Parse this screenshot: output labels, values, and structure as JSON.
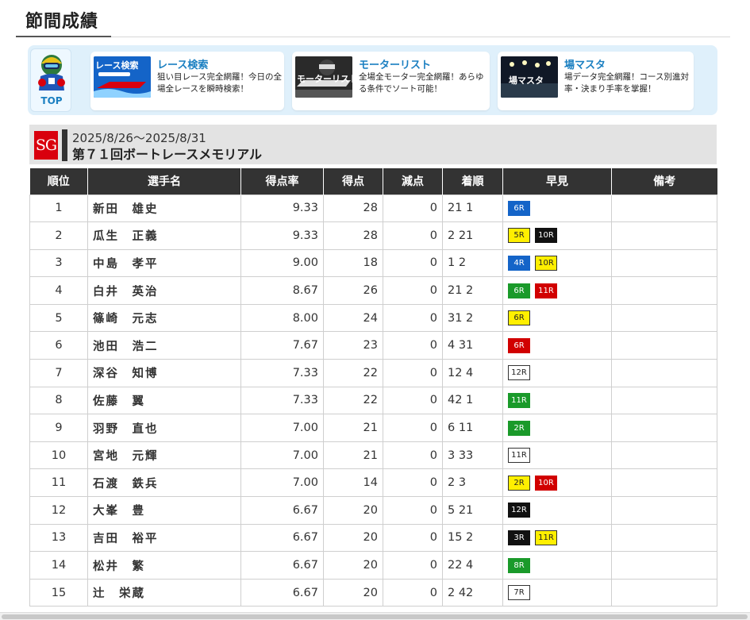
{
  "page_title": "節間成績",
  "nav": {
    "top_label": "TOP",
    "cards": [
      {
        "title": "レース検索",
        "desc": "狙い目レース完全網羅！今日の全場全レースを瞬時検索！",
        "thumb_text": "レース検索"
      },
      {
        "title": "モーターリスト",
        "desc": "全場全モーター完全網羅！あらゆる条件でソート可能！",
        "thumb_text": "モーターリスト"
      },
      {
        "title": "場マスタ",
        "desc": "場データ完全網羅！コース別進対率・決まり手率を掌握！",
        "thumb_text": "場マスタ"
      }
    ]
  },
  "race": {
    "grade": "SG",
    "dates": "2025/8/26〜2025/8/31",
    "name": "第７１回ボートレースメモリアル"
  },
  "table": {
    "headers": [
      "順位",
      "選手名",
      "得点率",
      "得点",
      "減点",
      "着順",
      "早見",
      "備考"
    ],
    "rows": [
      {
        "rank": "1",
        "name": "新田　雄史",
        "rate": "9.33",
        "points": "28",
        "deduct": "0",
        "order": "21 1",
        "tags": [
          {
            "label": "6R",
            "color": "blue"
          }
        ],
        "note": ""
      },
      {
        "rank": "2",
        "name": "瓜生　正義",
        "rate": "9.33",
        "points": "28",
        "deduct": "0",
        "order": "2 21",
        "tags": [
          {
            "label": "5R",
            "color": "yellow"
          },
          {
            "label": "10R",
            "color": "black"
          }
        ],
        "note": ""
      },
      {
        "rank": "3",
        "name": "中島　孝平",
        "rate": "9.00",
        "points": "18",
        "deduct": "0",
        "order": "1 2",
        "tags": [
          {
            "label": "4R",
            "color": "blue"
          },
          {
            "label": "10R",
            "color": "yellow"
          }
        ],
        "note": ""
      },
      {
        "rank": "4",
        "name": "白井　英治",
        "rate": "8.67",
        "points": "26",
        "deduct": "0",
        "order": "21 2",
        "tags": [
          {
            "label": "6R",
            "color": "green"
          },
          {
            "label": "11R",
            "color": "red"
          }
        ],
        "note": ""
      },
      {
        "rank": "5",
        "name": "篠崎　元志",
        "rate": "8.00",
        "points": "24",
        "deduct": "0",
        "order": "31 2",
        "tags": [
          {
            "label": "6R",
            "color": "yellow"
          }
        ],
        "note": ""
      },
      {
        "rank": "6",
        "name": "池田　浩二",
        "rate": "7.67",
        "points": "23",
        "deduct": "0",
        "order": "4 31",
        "tags": [
          {
            "label": "6R",
            "color": "red"
          }
        ],
        "note": ""
      },
      {
        "rank": "7",
        "name": "深谷　知博",
        "rate": "7.33",
        "points": "22",
        "deduct": "0",
        "order": "12 4",
        "tags": [
          {
            "label": "12R",
            "color": "white"
          }
        ],
        "note": ""
      },
      {
        "rank": "8",
        "name": "佐藤　翼",
        "rate": "7.33",
        "points": "22",
        "deduct": "0",
        "order": "42 1",
        "tags": [
          {
            "label": "11R",
            "color": "green"
          }
        ],
        "note": ""
      },
      {
        "rank": "9",
        "name": "羽野　直也",
        "rate": "7.00",
        "points": "21",
        "deduct": "0",
        "order": "6 11",
        "tags": [
          {
            "label": "2R",
            "color": "green"
          }
        ],
        "note": ""
      },
      {
        "rank": "10",
        "name": "宮地　元輝",
        "rate": "7.00",
        "points": "21",
        "deduct": "0",
        "order": "3 33",
        "tags": [
          {
            "label": "11R",
            "color": "white"
          }
        ],
        "note": ""
      },
      {
        "rank": "11",
        "name": "石渡　鉄兵",
        "rate": "7.00",
        "points": "14",
        "deduct": "0",
        "order": "2 3",
        "tags": [
          {
            "label": "2R",
            "color": "yellow"
          },
          {
            "label": "10R",
            "color": "red"
          }
        ],
        "note": ""
      },
      {
        "rank": "12",
        "name": "大峯　豊",
        "rate": "6.67",
        "points": "20",
        "deduct": "0",
        "order": "5 21",
        "tags": [
          {
            "label": "12R",
            "color": "black"
          }
        ],
        "note": ""
      },
      {
        "rank": "13",
        "name": "吉田　裕平",
        "rate": "6.67",
        "points": "20",
        "deduct": "0",
        "order": "15 2",
        "tags": [
          {
            "label": "3R",
            "color": "black"
          },
          {
            "label": "11R",
            "color": "yellow"
          }
        ],
        "note": ""
      },
      {
        "rank": "14",
        "name": "松井　繁",
        "rate": "6.67",
        "points": "20",
        "deduct": "0",
        "order": "22 4",
        "tags": [
          {
            "label": "8R",
            "color": "green"
          }
        ],
        "note": ""
      },
      {
        "rank": "15",
        "name": "辻　栄蔵",
        "rate": "6.67",
        "points": "20",
        "deduct": "0",
        "order": "2 42",
        "tags": [
          {
            "label": "7R",
            "color": "white"
          }
        ],
        "note": ""
      }
    ]
  },
  "colors": {
    "header_bg": "#333333",
    "accent_blue": "#1a7fc1",
    "sg_red": "#d9000d",
    "banner_bg": "#dff0fb"
  }
}
